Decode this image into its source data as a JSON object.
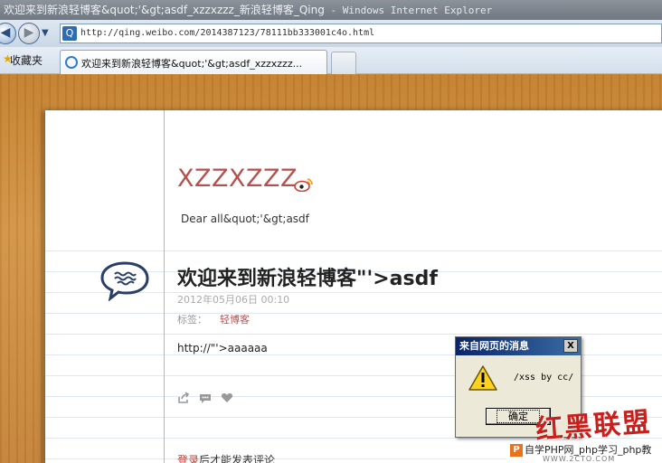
{
  "window": {
    "title": "欢迎来到新浪轻博客&quot;'&gt;asdf_xzzxzzz_新浪轻博客_Qing",
    "app_name": " - Windows Internet Explorer"
  },
  "address_bar": {
    "url": "http://qing.weibo.com/2014387123/78111bb333001c4o.html",
    "site_icon": "Q"
  },
  "favorites_bar": {
    "label": "收藏夹",
    "tab_label": "欢迎来到新浪轻博客&quot;'&gt;asdf_xzzxzzz..."
  },
  "blog": {
    "title": "XZZXZZZ",
    "description": "Dear all&quot;'&gt;asdf"
  },
  "post": {
    "title": "欢迎来到新浪轻博客\"'>asdf",
    "date": "2012年05月06日 00:10",
    "tags_label": "标签：",
    "tag": "轻博客",
    "body": "http://\"'>aaaaaa"
  },
  "actions": {
    "share_icon": "share-icon",
    "comment_icon": "comment-icon",
    "like_icon": "heart-icon"
  },
  "login_prompt": {
    "link": "登录",
    "text": "后才能发表评论"
  },
  "alert": {
    "title": "来自网页的消息",
    "close": "X",
    "message": "/xss by cc/",
    "ok": "确定"
  },
  "watermark": {
    "brand": "红黑联盟",
    "site": "自学PHP网_php学习_php教",
    "url": "WWW.2CTO.COM"
  },
  "colors": {
    "accent": "#b5504f",
    "dialog_title": "#0a246a"
  }
}
